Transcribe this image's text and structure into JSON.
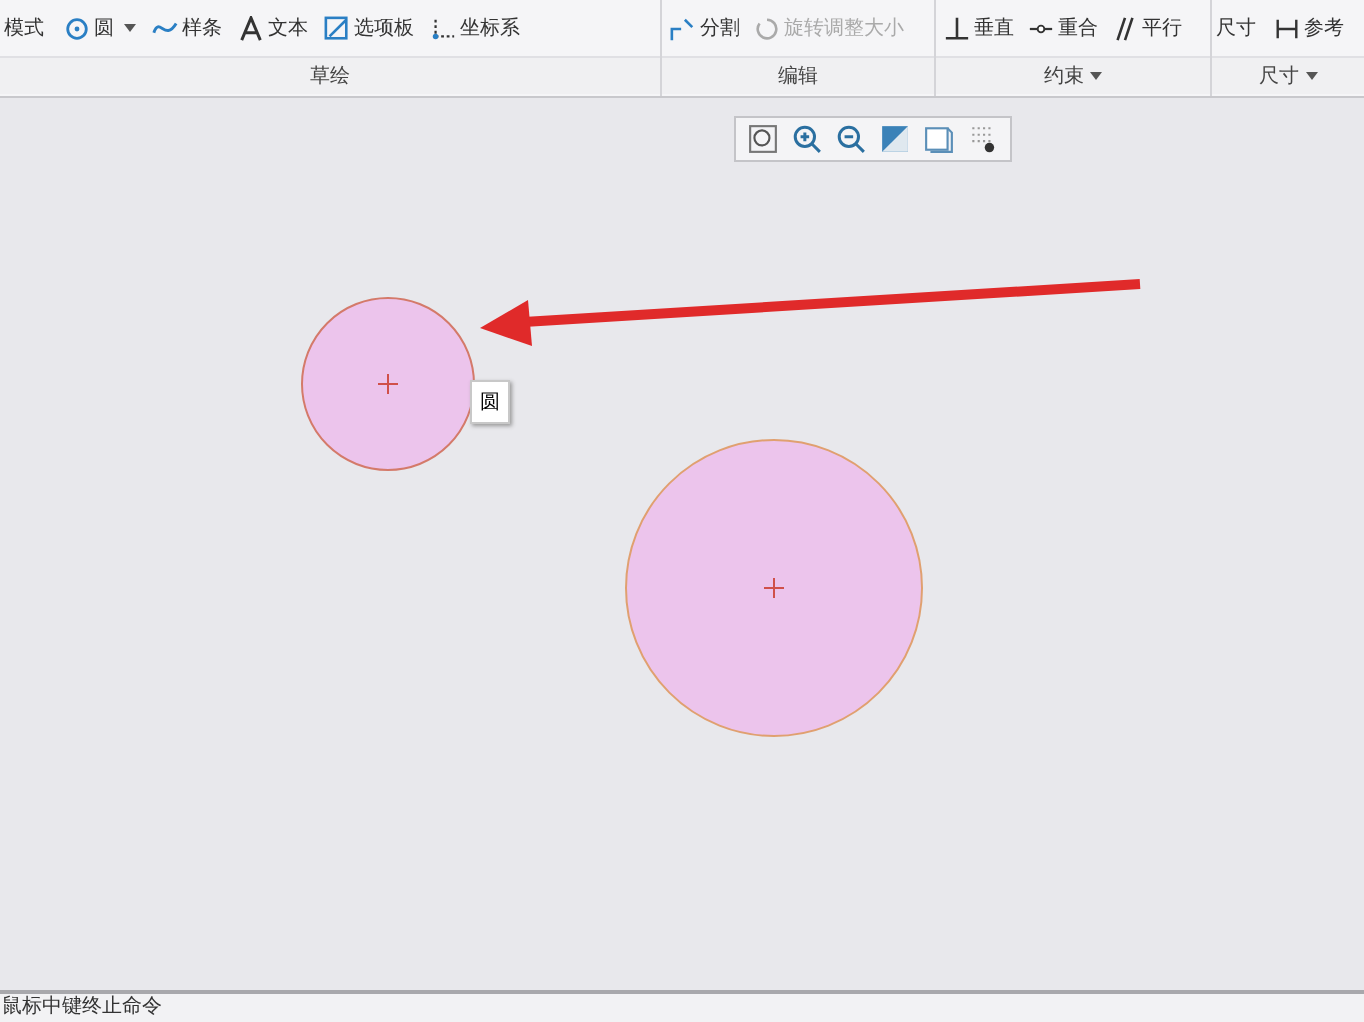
{
  "ribbon": {
    "top_left_text": "模式",
    "top_right_text": "尺寸",
    "groups": [
      {
        "label": "草绘",
        "has_menu": false,
        "tools": [
          {
            "label": "圆",
            "dropdown": true,
            "disabled": false
          },
          {
            "label": "样条",
            "dropdown": false,
            "disabled": false
          },
          {
            "label": "文本",
            "dropdown": false,
            "disabled": false
          },
          {
            "label": "选项板",
            "dropdown": false,
            "disabled": false
          },
          {
            "label": "坐标系",
            "dropdown": false,
            "disabled": false
          }
        ]
      },
      {
        "label": "编辑",
        "has_menu": false,
        "tools": [
          {
            "label": "分割",
            "dropdown": false,
            "disabled": false
          },
          {
            "label": "旋转调整大小",
            "dropdown": false,
            "disabled": true
          }
        ]
      },
      {
        "label": "约束",
        "has_menu": true,
        "tools": [
          {
            "label": "垂直",
            "dropdown": false,
            "disabled": false
          },
          {
            "label": "重合",
            "dropdown": false,
            "disabled": false
          },
          {
            "label": "平行",
            "dropdown": false,
            "disabled": false
          }
        ]
      },
      {
        "label": "尺寸",
        "has_menu": true,
        "tools": [
          {
            "label": "参考",
            "dropdown": false,
            "disabled": false
          }
        ]
      }
    ]
  },
  "canvas": {
    "tooltip": "圆"
  },
  "status_bar": {
    "message": "鼠标中键终止命令"
  }
}
